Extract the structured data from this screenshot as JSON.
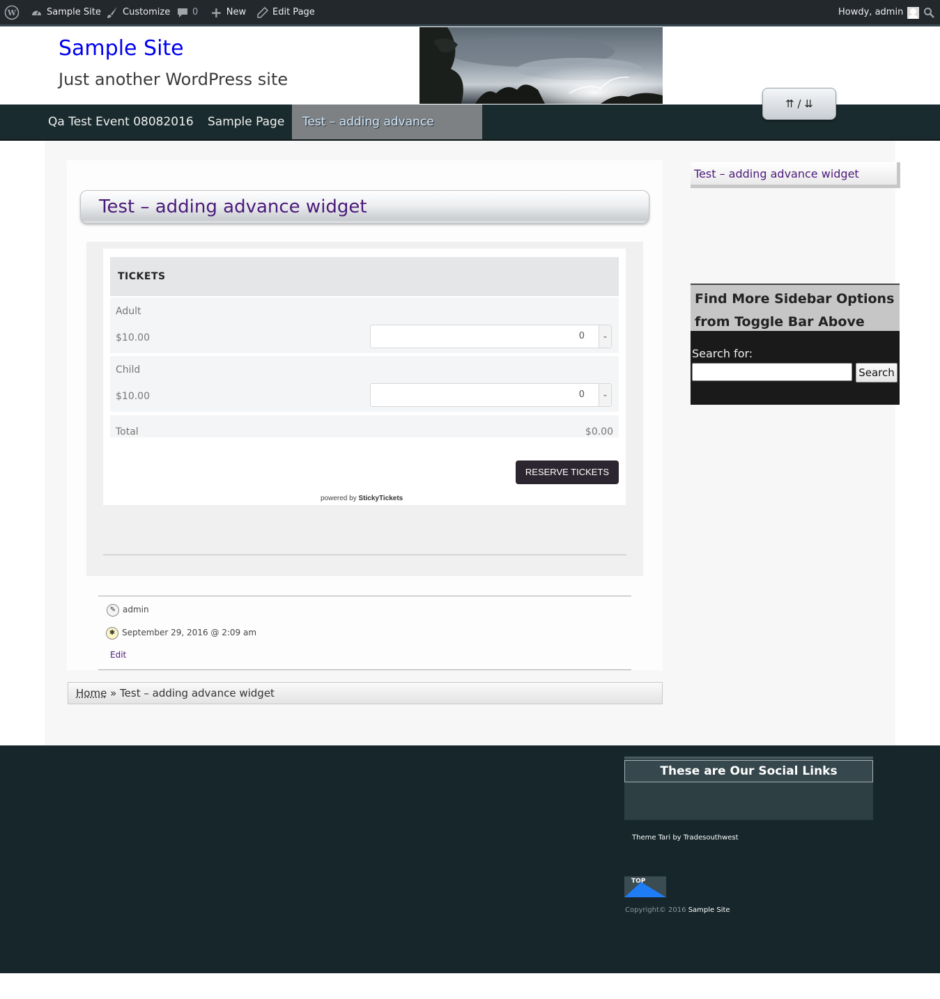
{
  "adminbar": {
    "site": "Sample Site",
    "customize": "Customize",
    "comments_count": "0",
    "new": "New",
    "edit_page": "Edit Page",
    "howdy": "Howdy, admin"
  },
  "header": {
    "site_title": "Sample Site",
    "tagline": "Just another WordPress site",
    "toggle": "⇈ / ⇊"
  },
  "nav": {
    "items": [
      {
        "label": "Qa Test Event 08082016"
      },
      {
        "label": "Sample Page"
      },
      {
        "label": "Test – adding advance widget"
      }
    ]
  },
  "page": {
    "title": "Test – adding advance widget"
  },
  "tickets": {
    "heading": "TICKETS",
    "rows": [
      {
        "name": "Adult",
        "price": "$10.00",
        "qty": "0"
      },
      {
        "name": "Child",
        "price": "$10.00",
        "qty": "0"
      }
    ],
    "total_label": "Total",
    "total_value": "$0.00",
    "reserve": "RESERVE TICKETS",
    "powered_prefix": "powered by",
    "powered_brand": "StickyTickets"
  },
  "meta": {
    "author": "admin",
    "date": "September 29, 2016 @ 2:09 am",
    "edit": "Edit"
  },
  "breadcrumb": {
    "home": "Home",
    "separator": "»",
    "current": "Test – adding advance widget"
  },
  "sidebar": {
    "page_link": "Test – adding advance widget",
    "widget_title": "Find More Sidebar Options from Toggle Bar Above",
    "search_label": "Search for:",
    "search_button": "Search"
  },
  "footer": {
    "social_title": "These are Our Social Links",
    "theme_credit": "Theme Tari by Tradesouthwest",
    "top": "TOP",
    "copyright_prefix": "Copyright© 2016",
    "copyright_site": "Sample Site"
  },
  "colors": {
    "admin_bar": "#23282d",
    "nav_bg": "#1a2b2f",
    "title_purple": "#4b1a7a",
    "footer_bg": "#16262b",
    "top_blue": "#1e7cf5"
  }
}
